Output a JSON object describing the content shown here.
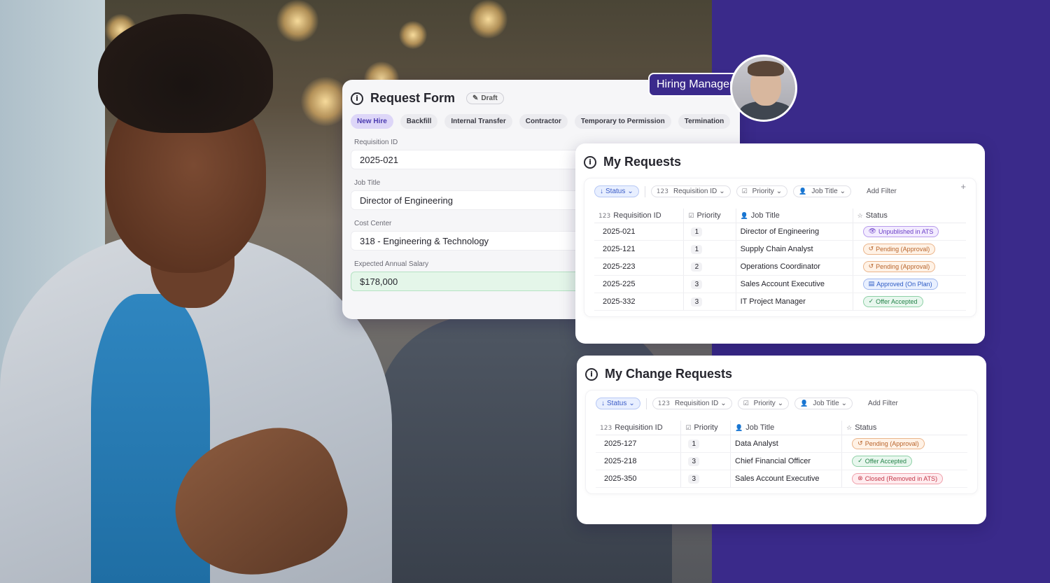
{
  "hiring_manager": {
    "label": "Hiring Manager"
  },
  "request_form": {
    "title": "Request Form",
    "draft_label": "Draft",
    "tabs": [
      {
        "label": "New Hire",
        "active": true
      },
      {
        "label": "Backfill",
        "active": false
      },
      {
        "label": "Internal Transfer",
        "active": false
      },
      {
        "label": "Contractor",
        "active": false
      },
      {
        "label": "Temporary to Permission",
        "active": false
      },
      {
        "label": "Termination",
        "active": false
      }
    ],
    "fields": [
      {
        "label": "Requisition ID",
        "value": "2025-021"
      },
      {
        "label": "Job Title",
        "value": "Director of Engineering"
      },
      {
        "label": "Cost Center",
        "value": "318 - Engineering & Technology"
      },
      {
        "label": "Expected Annual Salary",
        "value": "$178,000"
      }
    ]
  },
  "my_requests": {
    "title": "My Requests",
    "filters": [
      "Status",
      "Requisition ID",
      "Priority",
      "Job Title"
    ],
    "add_filter": "Add Filter",
    "columns": [
      "Requisition ID",
      "Priority",
      "Job Title",
      "Status"
    ],
    "rows": [
      {
        "id": "2025-021",
        "priority": "1",
        "job": "Director of Engineering",
        "status": "Unpublished in ATS",
        "tone": "purple"
      },
      {
        "id": "2025-121",
        "priority": "1",
        "job": "Supply Chain Analyst",
        "status": "Pending (Approval)",
        "tone": "orange"
      },
      {
        "id": "2025-223",
        "priority": "2",
        "job": "Operations Coordinator",
        "status": "Pending (Approval)",
        "tone": "orange"
      },
      {
        "id": "2025-225",
        "priority": "3",
        "job": "Sales Account Executive",
        "status": "Approved (On Plan)",
        "tone": "blue"
      },
      {
        "id": "2025-332",
        "priority": "3",
        "job": "IT Project Manager",
        "status": "Offer Accepted",
        "tone": "green"
      }
    ]
  },
  "my_change_requests": {
    "title": "My Change Requests",
    "filters": [
      "Status",
      "Requisition ID",
      "Priority",
      "Job Title"
    ],
    "add_filter": "Add Filter",
    "columns": [
      "Requisition ID",
      "Priority",
      "Job Title",
      "Status"
    ],
    "rows": [
      {
        "id": "2025-127",
        "priority": "1",
        "job": "Data Analyst",
        "status": "Pending (Approval)",
        "tone": "orange"
      },
      {
        "id": "2025-218",
        "priority": "3",
        "job": "Chief Financial Officer",
        "status": "Offer Accepted",
        "tone": "green"
      },
      {
        "id": "2025-350",
        "priority": "3",
        "job": "Sales Account Executive",
        "status": "Closed (Removed in ATS)",
        "tone": "red"
      }
    ]
  },
  "colors": {
    "brand_purple": "#3b2a8c",
    "active_tab": "#ddd6f8",
    "salary_green": "#e4f6e9"
  }
}
